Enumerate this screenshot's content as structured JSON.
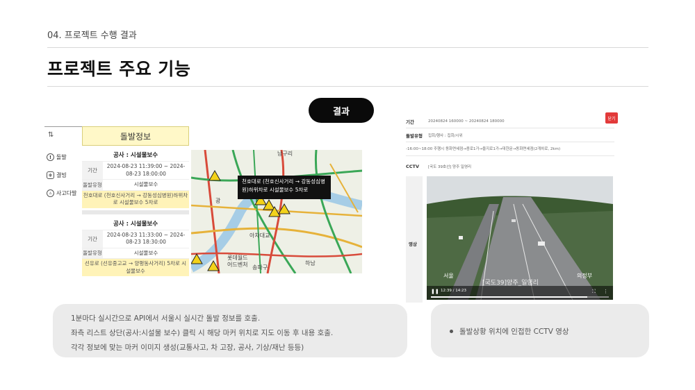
{
  "header": {
    "section_label": "04. 프로젝트 수행 결과",
    "page_title": "프로젝트 주요 기능"
  },
  "result_button": {
    "label": "결과"
  },
  "left_panel": {
    "sort_icon": "sort-icon",
    "sidebar_items": [
      {
        "label": "돌발",
        "icon": "alert-circle-icon"
      },
      {
        "label": "결빙",
        "icon": "snow-cloud-icon"
      },
      {
        "label": "사고다발",
        "icon": "accident-icon"
      }
    ],
    "list_header": "돌발정보",
    "cards": [
      {
        "title": "공사 : 시설물보수",
        "period_label": "기간",
        "period_value": "2024-08-23 11:39:00 ~ 2024-08-23 18:00:00",
        "type_label": "돌발유형",
        "type_value": "시설물보수",
        "route": "천호대로 (천호신사거리 → 강동성심병원)하위차로 시설물보수 5차로"
      },
      {
        "title": "공사 : 시설물보수",
        "period_label": "기간",
        "period_value": "2024-08-23 11:33:00 ~ 2024-08-23 18:30:00",
        "type_label": "돌발유형",
        "type_value": "시설물보수",
        "route": "선유로 (선유중고교 → 양평동사거리) 5차로 시설물보수"
      }
    ]
  },
  "map": {
    "tooltip": "천호대로 (천호신사거리 → 강동성심병원)하위차로 시설물보수 5차로",
    "labels": [
      "남구리",
      "광",
      "아차대교",
      "롯데월드",
      "어드벤처",
      "송파구",
      "하남"
    ],
    "marker_icon": "warning-marker-icon"
  },
  "detail_panel": {
    "rows": [
      {
        "label": "기간",
        "value": "20240824 160000 ~ 20240824 180000"
      },
      {
        "label": "돌발유형",
        "value": "집회/행사 : 집회/시위"
      },
      {
        "label": "",
        "value": "-16:00~18:00 주행시 동화면세점→종로1가→을지로1가→대한문→동화면세점(2개차로, 2km)"
      },
      {
        "label": "CCTV",
        "value": "[국도 39호선] 양주 일영리"
      }
    ],
    "close_label": "닫기",
    "video_label": "영상",
    "video_overlay": {
      "location": "[국도39]양주_일영리",
      "left_text": "서울",
      "right_text": "의정부",
      "time": "12:39 / 14:23"
    }
  },
  "bottom_left": {
    "lines": [
      "1분마다 실시간으로 API에서 서울시 실시간 돌발 정보를 호출.",
      "좌측 리스트 상단(공사:시설물 보수) 클릭 시 해당 마커 위치로 지도 이동 후 내용 호출.",
      "각각 정보에 맞는 마커 이미지 생성(교통사고, 차 고장, 공사, 기상/재난 등등)"
    ]
  },
  "bottom_right": {
    "bullet": "돌발상황 위치에 인접한 CCTV 영상"
  }
}
